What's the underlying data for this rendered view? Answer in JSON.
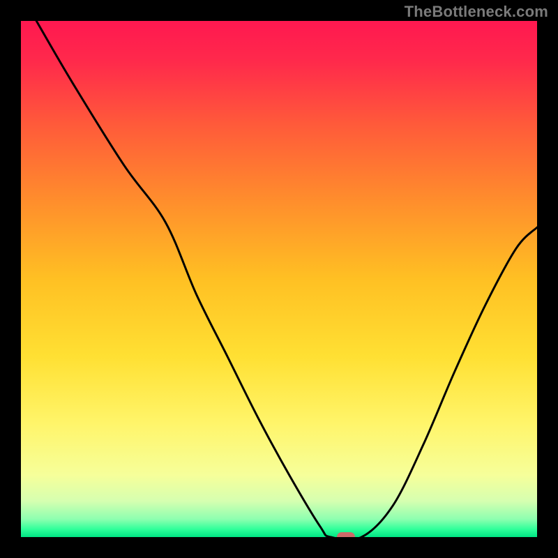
{
  "watermark": "TheBottleneck.com",
  "chart_data": {
    "type": "line",
    "title": "",
    "xlabel": "",
    "ylabel": "",
    "xlim": [
      0,
      100
    ],
    "ylim": [
      0,
      100
    ],
    "grid": false,
    "axes_visible": false,
    "background": "gradient",
    "gradient_stops": [
      {
        "pos": 0.0,
        "color": "#ff1850"
      },
      {
        "pos": 0.08,
        "color": "#ff2a4b"
      },
      {
        "pos": 0.2,
        "color": "#ff5a3a"
      },
      {
        "pos": 0.35,
        "color": "#ff8e2c"
      },
      {
        "pos": 0.5,
        "color": "#ffc023"
      },
      {
        "pos": 0.65,
        "color": "#ffe033"
      },
      {
        "pos": 0.78,
        "color": "#fff56a"
      },
      {
        "pos": 0.88,
        "color": "#f6ff9a"
      },
      {
        "pos": 0.93,
        "color": "#d6ffb0"
      },
      {
        "pos": 0.965,
        "color": "#8effb0"
      },
      {
        "pos": 0.985,
        "color": "#2eff9a"
      },
      {
        "pos": 1.0,
        "color": "#00e584"
      }
    ],
    "series": [
      {
        "name": "curve",
        "stroke": "#000000",
        "x": [
          3.0,
          10.0,
          20.0,
          28.0,
          34.0,
          40.0,
          46.0,
          52.0,
          58.0,
          60.0,
          66.0,
          72.0,
          78.0,
          84.0,
          90.0,
          96.0,
          100.0
        ],
        "y": [
          100.0,
          88.0,
          72.0,
          61.0,
          47.0,
          35.0,
          23.0,
          12.0,
          2.0,
          0.0,
          0.0,
          6.0,
          18.0,
          32.0,
          45.0,
          56.0,
          60.0
        ]
      }
    ],
    "marker": {
      "x": 63.0,
      "y": 0.0,
      "color": "#cd6a69",
      "shape": "rounded-rect"
    }
  }
}
